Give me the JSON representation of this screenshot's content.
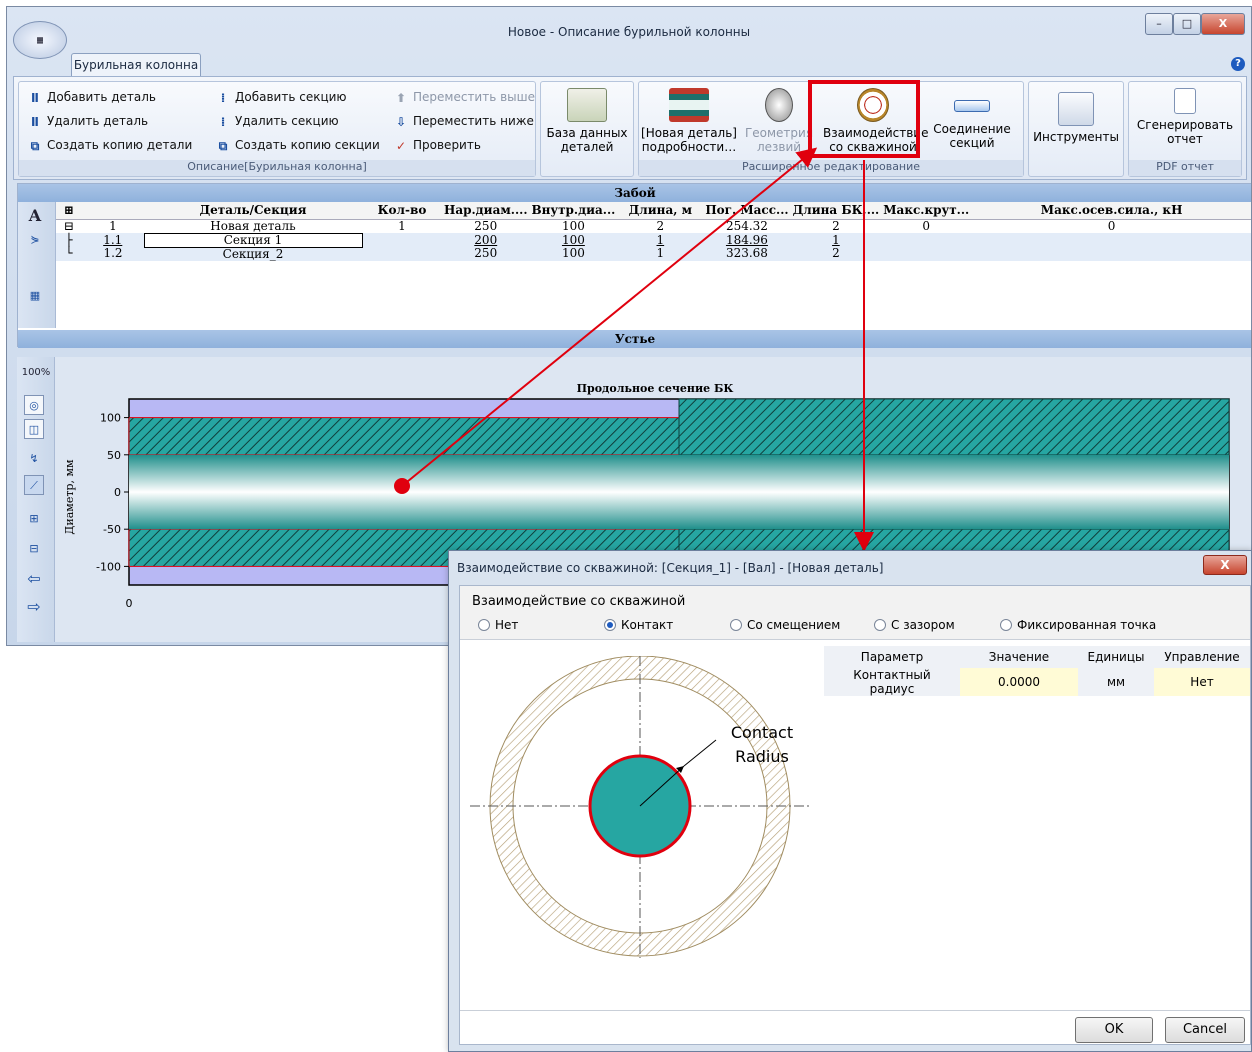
{
  "window": {
    "title": "Новое - Описание бурильной колонны",
    "minimize": "–",
    "maximize": "□",
    "close": "X"
  },
  "ribbon": {
    "tab": "Бурильная колонна",
    "group1": {
      "add_part": "Добавить деталь",
      "delete_part": "Удалить деталь",
      "copy_part": "Создать копию детали",
      "add_section": "Добавить секцию",
      "delete_section": "Удалить секцию",
      "copy_section": "Создать копию секции",
      "move_up": "Переместить выше",
      "move_down": "Переместить ниже",
      "check": "Проверить",
      "label": "Описание[Бурильная колонна]"
    },
    "parts_db": [
      "База данных",
      "деталей"
    ],
    "group2": {
      "new_part_details": [
        "[Новая деталь]",
        "подробности…"
      ],
      "geometry": [
        "Геометрия",
        "лезвий"
      ],
      "borehole_interaction": [
        "Взаимодействие",
        "со скважиной"
      ],
      "section_connection": [
        "Соединение",
        "секций"
      ],
      "label": "Расширенное редактирование"
    },
    "tools": "Инструменты",
    "pdf": {
      "generate": [
        "Сгенерировать",
        "отчет"
      ],
      "label": "PDF отчет"
    }
  },
  "grid": {
    "top_band": "Забой",
    "bottom_band": "Устье",
    "columns": [
      "Деталь/Секция",
      "Кол-во",
      "Нар.диам....",
      "Внутр.диа...",
      "Длина, м",
      "Пог. Масс...",
      "Длина БК,...",
      "Макс.крут...",
      "Макс.осев.сила., кН"
    ],
    "rows": [
      {
        "num": "1",
        "name": "Новая деталь",
        "qty": "1",
        "od": "250",
        "id": "100",
        "len": "2",
        "mass": "254.32",
        "bk_len": "2",
        "torque": "0",
        "axial": "0"
      },
      {
        "num": "1.1",
        "name": "Секция 1",
        "qty": "",
        "od": "200",
        "id": "100",
        "len": "1",
        "mass": "184.96",
        "bk_len": "1",
        "torque": "",
        "axial": ""
      },
      {
        "num": "1.2",
        "name": "Секция_2",
        "qty": "",
        "od": "250",
        "id": "100",
        "len": "1",
        "mass": "323.68",
        "bk_len": "2",
        "torque": "",
        "axial": ""
      }
    ]
  },
  "side_strip": {
    "zoom": "100%"
  },
  "chart_data": {
    "type": "area",
    "title": "Продольное сечение БК",
    "ylabel": "Диаметр, мм",
    "yticks": [
      "100",
      "50",
      "0",
      "-50",
      "-100"
    ],
    "xticks": [
      "0"
    ],
    "ylim": [
      -125,
      125
    ],
    "series": [
      {
        "name": "Секция 1",
        "x": [
          0,
          1
        ],
        "outer_diameter": 200,
        "inner_diameter": 100
      },
      {
        "name": "Секция_2",
        "x": [
          1,
          2
        ],
        "outer_diameter": 250,
        "inner_diameter": 100
      }
    ]
  },
  "dialog": {
    "title": "Взаимодействие со скважиной: [Секция_1] - [Вал] - [Новая деталь]",
    "close": "X",
    "group_label": "Взаимодействие со скважиной",
    "options": [
      "Нет",
      "Контакт",
      "Со смещением",
      "С зазором",
      "Фиксированная точка"
    ],
    "selected": "Контакт",
    "param_headers": [
      "Параметр",
      "Значение",
      "Единицы",
      "Управление"
    ],
    "param_row": {
      "name": "Контактный радиус",
      "value": "0.0000",
      "unit": "мм",
      "control": "Нет"
    },
    "diagram_labels": [
      "Contact",
      "Radius"
    ],
    "ok": "OK",
    "cancel": "Cancel"
  },
  "colors": {
    "highlight": "#e0000e",
    "pipe_teal": "#26a6a2",
    "hatch_dark": "#1f6f6a",
    "chart_bg": "#b8b8f4"
  }
}
